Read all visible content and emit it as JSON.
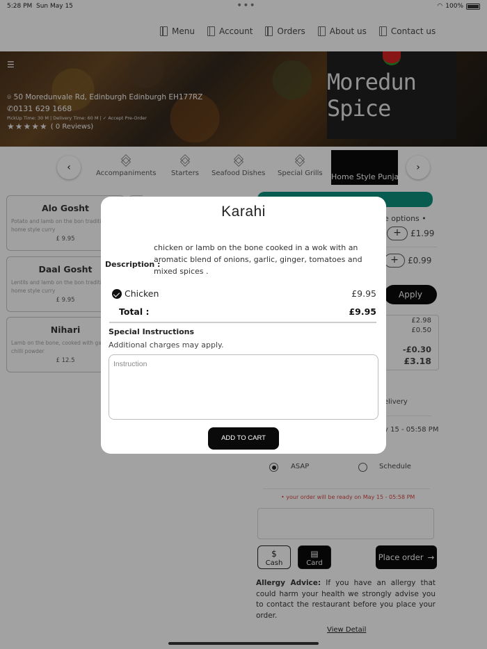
{
  "status": {
    "time": "5:28 PM",
    "date": "Sun May 15",
    "battery": "100%"
  },
  "nav": {
    "menu": "Menu",
    "account": "Account",
    "orders": "Orders",
    "about": "About us",
    "contact": "Contact us"
  },
  "restaurant": {
    "name": "Moredun Spice",
    "address": "50 Moredunvale Rd, Edinburgh Edinburgh EH177RZ",
    "phone": "0131 629 1668",
    "times": "PickUp Time: 30 M | Delivery Time: 60 M |",
    "preorder": "Accept Pre-Order",
    "stars": "★★★★★",
    "reviews": "( 0 Reviews)"
  },
  "categories": [
    "Accompaniments",
    "Starters",
    "Seafood Dishes",
    "Special Grills",
    "Home Style Punja"
  ],
  "items": [
    {
      "title": "Alo Gosht",
      "desc": "Potato and lamb on the bon traditional home style curry",
      "price": "£ 9.95"
    },
    {
      "title": "Daal Gosht",
      "desc": "Lentils and lamb on the bon traditional home style curry",
      "price": "£ 9.95"
    },
    {
      "title": "Nihari",
      "desc": "Lamb on the bone, cooked with garlic, chilli powder",
      "price": "£ 12.5"
    }
  ],
  "cart": {
    "options_text": "e options •",
    "plus": "+",
    "price_1": "£1.99",
    "price_2": "£0.99",
    "apply": "Apply",
    "subtotal": "£2.98",
    "fee": "£0.50",
    "discount": "-£0.30",
    "total": "£3.18",
    "delivery": "elivery",
    "schedule_date": "y 15 - 05:58 PM",
    "asap": "ASAP",
    "schedule": "Schedule",
    "ready_note": "• your order will be ready on May 15 - 05:58 PM",
    "cash": "Cash",
    "card": "Card",
    "place_order": "Place order",
    "allergy_label": "Allergy Advice:",
    "allergy_text": " If you have an allergy that could harm your health we strongly advise you to contact the restaurant before you place your order.",
    "view_detail": "View Detail"
  },
  "modal": {
    "title": "Karahi",
    "desc_label": "Description :",
    "desc_text": "chicken or lamb on the bone cooked in a wok with an aromatic blend of onions, garlic, ginger, tomatoes and mixed spices .",
    "option_name": "Chicken",
    "option_price": "£9.95",
    "total_label": "Total :",
    "total_value": "£9.95",
    "si_title": "Special Instructions",
    "si_note": "Additional charges may apply.",
    "placeholder": "Instruction",
    "add_button": "ADD TO CART"
  }
}
